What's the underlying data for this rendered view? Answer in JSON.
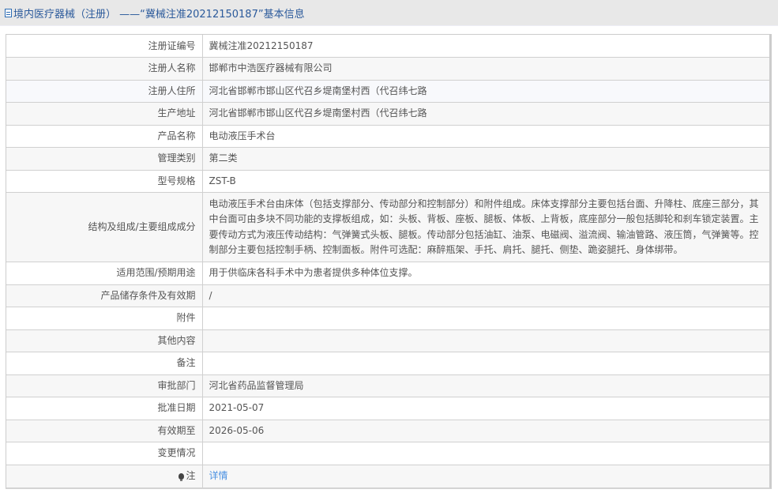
{
  "header": {
    "icon": "document-icon",
    "title": "境内医疗器械（注册） ——“冀械注准20212150187”基本信息"
  },
  "rows": [
    {
      "label": "注册证编号",
      "value": "冀械注准20212150187"
    },
    {
      "label": "注册人名称",
      "value": "邯郸市中浩医疗器械有限公司"
    },
    {
      "label": "注册人住所",
      "value": "河北省邯郸市邯山区代召乡堤南堡村西（代召纬七路"
    },
    {
      "label": "生产地址",
      "value": "河北省邯郸市邯山区代召乡堤南堡村西（代召纬七路"
    },
    {
      "label": "产品名称",
      "value": "电动液压手术台"
    },
    {
      "label": "管理类别",
      "value": "第二类"
    },
    {
      "label": "型号规格",
      "value": "ZST-B"
    },
    {
      "label": "结构及组成/主要组成成分",
      "value": "电动液压手术台由床体（包括支撑部分、传动部分和控制部分）和附件组成。床体支撑部分主要包括台面、升降柱、底座三部分，其中台面可由多块不同功能的支撑板组成，如：头板、背板、座板、腿板、体板、上背板，底座部分一般包括脚轮和刹车锁定装置。主要传动方式为液压传动结构：气弹簧式头板、腿板。传动部分包括油缸、油泵、电磁阀、溢流阀、输油管路、液压筒，气弹簧等。控制部分主要包括控制手柄、控制面板。附件可选配：麻醉瓶架、手托、肩托、腿托、侧垫、跪姿腿托、身体绑带。"
    },
    {
      "label": "适用范围/预期用途",
      "value": "用于供临床各科手术中为患者提供多种体位支撑。"
    },
    {
      "label": "产品储存条件及有效期",
      "value": "/"
    },
    {
      "label": "附件",
      "value": ""
    },
    {
      "label": "其他内容",
      "value": ""
    },
    {
      "label": "备注",
      "value": ""
    },
    {
      "label": "审批部门",
      "value": "河北省药品监督管理局"
    },
    {
      "label": "批准日期",
      "value": "2021-05-07"
    },
    {
      "label": "有效期至",
      "value": "2026-05-06"
    },
    {
      "label": "变更情况",
      "value": ""
    },
    {
      "label": "注",
      "icon": "lightbulb-icon",
      "value": "详情"
    }
  ],
  "colors": {
    "title": "#2b5a9b",
    "link": "#4a90e2",
    "text": "#555555",
    "title_bar_bg": "#e8e8e8",
    "row_alt_bg": "#f7f7f7",
    "border": "#d0d0d0"
  }
}
